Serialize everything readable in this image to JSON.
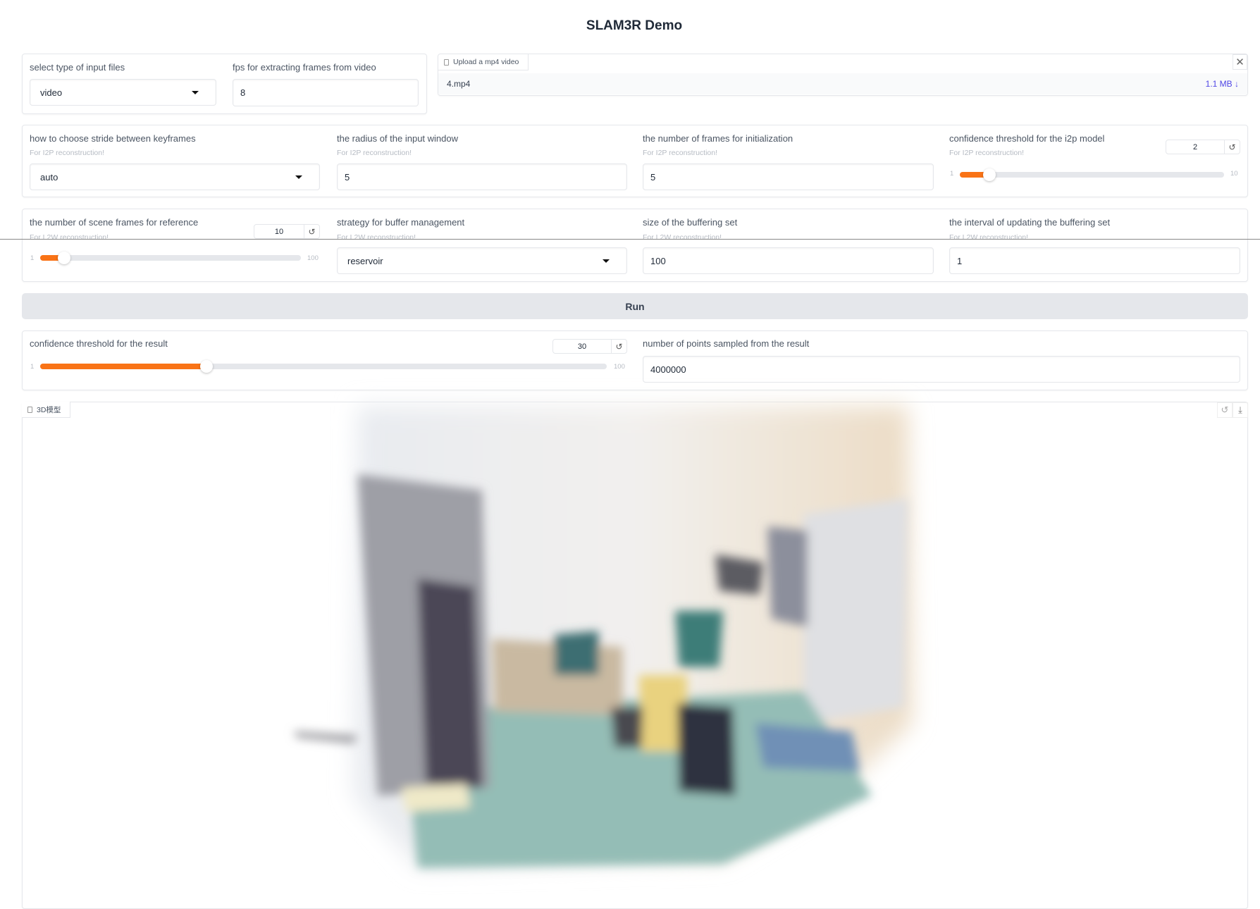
{
  "title": "SLAM3R Demo",
  "input_type": {
    "label": "select type of input files",
    "value": "video"
  },
  "fps": {
    "label": "fps for extracting frames from video",
    "value": "8"
  },
  "upload": {
    "tab_label": "Upload a mp4 video",
    "file_name": "4.mp4",
    "file_size": "1.1 MB ↓"
  },
  "i2p": {
    "sublabel": "For I2P reconstruction!",
    "stride": {
      "label": "how to choose stride between keyframes",
      "value": "auto"
    },
    "radius": {
      "label": "the radius of the input window",
      "value": "5"
    },
    "init_frames": {
      "label": "the number of frames for initialization",
      "value": "5"
    },
    "conf": {
      "label": "confidence threshold for the i2p model",
      "value": "2",
      "min": "1",
      "max": "10",
      "fraction": 0.111
    }
  },
  "l2w": {
    "sublabel": "For L2W reconstruction!",
    "scene_frames": {
      "label": "the number of scene frames for reference",
      "value": "10",
      "min": "1",
      "max": "100",
      "fraction": 0.091
    },
    "buffer_strategy": {
      "label": "strategy for buffer management",
      "value": "reservoir"
    },
    "buffer_size": {
      "label": "size of the buffering set",
      "value": "100"
    },
    "buffer_interval": {
      "label": "the interval of updating the buffering set",
      "value": "1"
    }
  },
  "run_label": "Run",
  "result": {
    "conf": {
      "label": "confidence threshold for the result",
      "value": "30",
      "min": "1",
      "max": "100",
      "fraction": 0.293
    },
    "points": {
      "label": "number of points sampled from the result",
      "value": "4000000"
    }
  },
  "model3d": {
    "label": "3D模型"
  },
  "colors": {
    "accent": "#f97316",
    "link": "#4f46e5"
  }
}
